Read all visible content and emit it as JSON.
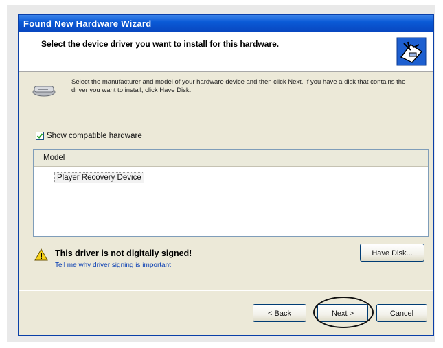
{
  "window": {
    "title": "Found New Hardware Wizard"
  },
  "header": {
    "title": "Select the device driver you want to install for this hardware.",
    "icon": "hardware-wizard-icon"
  },
  "instructions": {
    "text": "Select the manufacturer and model of your hardware device and then click Next. If you have a disk that contains the driver you want to install, click Have Disk."
  },
  "compatible": {
    "label": "Show compatible hardware",
    "checked": true
  },
  "list": {
    "header": "Model",
    "items": [
      "Player Recovery Device"
    ]
  },
  "warning": {
    "title": "This driver is not digitally signed!",
    "link": "Tell me why driver signing is important",
    "icon": "warning-icon"
  },
  "buttons": {
    "have_disk": "Have Disk...",
    "back": "< Back",
    "next": "Next >",
    "cancel": "Cancel"
  },
  "colors": {
    "titlebar": "#0a5ad6",
    "dialog_bg": "#ece9d8",
    "link": "#0a3fb4"
  }
}
